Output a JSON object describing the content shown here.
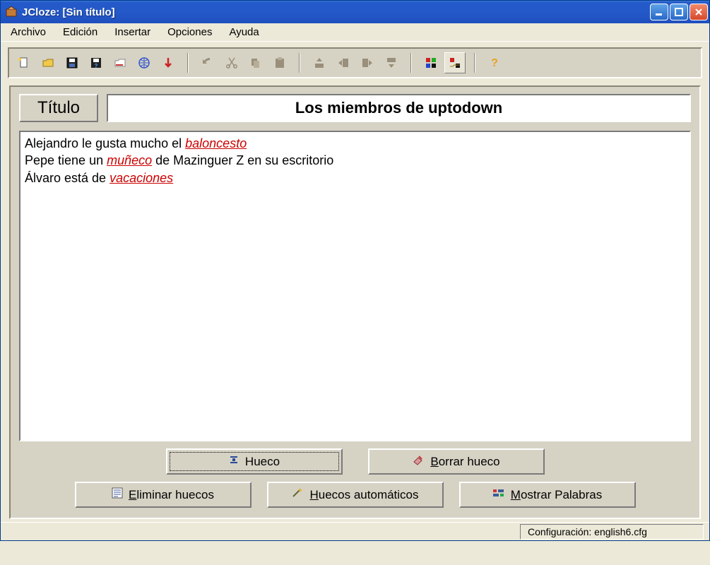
{
  "window": {
    "title": "JCloze: [Sin título]"
  },
  "menus": {
    "archivo": "Archivo",
    "edicion": "Edición",
    "insertar": "Insertar",
    "opciones": "Opciones",
    "ayuda": "Ayuda"
  },
  "labels": {
    "titulo": "Título"
  },
  "form": {
    "title_value": "Los miembros de uptodown"
  },
  "editor": {
    "line1_pre": "Alejandro le gusta mucho el ",
    "line1_gap": "baloncesto",
    "line2_pre": "Pepe tiene un ",
    "line2_gap": "muñeco",
    "line2_post": " de Mazinguer Z en su escritorio",
    "line3_pre": "Álvaro está de ",
    "line3_gap": "vacaciones"
  },
  "buttons": {
    "hueco": "Hueco",
    "borrar_hueco_pre": "B",
    "borrar_hueco_rest": "orrar hueco",
    "eliminar_pre": "E",
    "eliminar_rest": "liminar huecos",
    "auto_pre": "H",
    "auto_rest": "uecos automáticos",
    "mostrar_pre": "M",
    "mostrar_rest": "ostrar Palabras"
  },
  "status": {
    "config": "Configuración: english6.cfg"
  }
}
